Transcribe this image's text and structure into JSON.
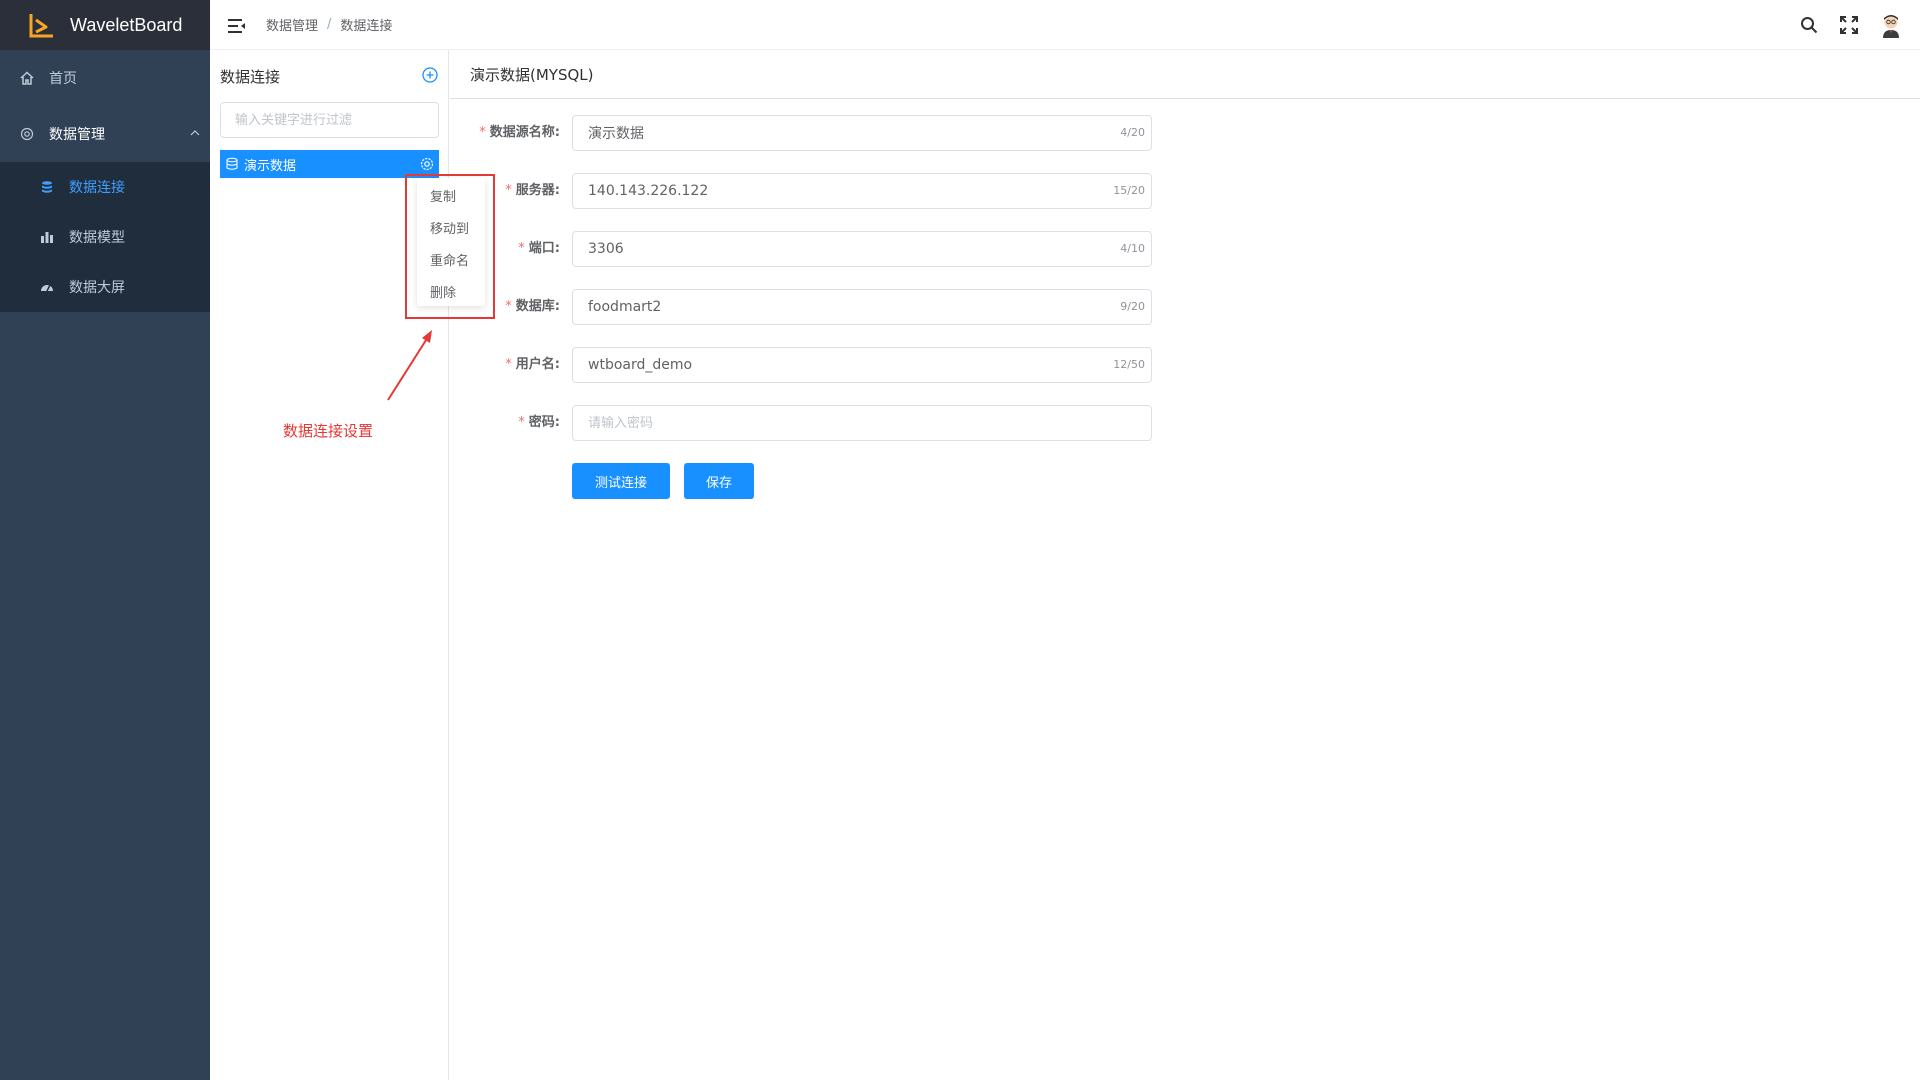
{
  "app": {
    "name": "WaveletBoard"
  },
  "sidebar": {
    "items": [
      {
        "label": "首页",
        "icon": "home-icon"
      },
      {
        "label": "数据管理",
        "icon": "setting-icon"
      }
    ],
    "submenu": [
      {
        "label": "数据连接",
        "icon": "database-icon",
        "active": true
      },
      {
        "label": "数据模型",
        "icon": "bar-chart-icon"
      },
      {
        "label": "数据大屏",
        "icon": "dashboard-icon"
      }
    ]
  },
  "header": {
    "breadcrumb": [
      "数据管理",
      "数据连接"
    ],
    "breadcrumb_sep": "/"
  },
  "tree": {
    "title": "数据连接",
    "filter_placeholder": "输入关键字进行过滤",
    "node_label": "演示数据",
    "context_menu": [
      "复制",
      "移动到",
      "重命名",
      "删除"
    ],
    "annotation": "数据连接设置"
  },
  "form": {
    "title": "演示数据(MYSQL)",
    "fields": [
      {
        "label": "数据源名称:",
        "value": "演示数据",
        "count": "4/20",
        "placeholder": ""
      },
      {
        "label": "服务器:",
        "value": "140.143.226.122",
        "count": "15/20",
        "placeholder": ""
      },
      {
        "label": "端口:",
        "value": "3306",
        "count": "4/10",
        "placeholder": ""
      },
      {
        "label": "数据库:",
        "value": "foodmart2",
        "count": "9/20",
        "placeholder": ""
      },
      {
        "label": "用户名:",
        "value": "wtboard_demo",
        "count": "12/50",
        "placeholder": ""
      },
      {
        "label": "密码:",
        "value": "",
        "count": "",
        "placeholder": "请输入密码"
      }
    ],
    "required_mark": "*",
    "test_button": "测试连接",
    "save_button": "保存"
  },
  "colors": {
    "sidebar_bg": "#304156",
    "logo_bg": "#2b2f3a",
    "submenu_bg": "#1f2d3d",
    "accent": "#1890ff",
    "annotation": "#e53935"
  }
}
